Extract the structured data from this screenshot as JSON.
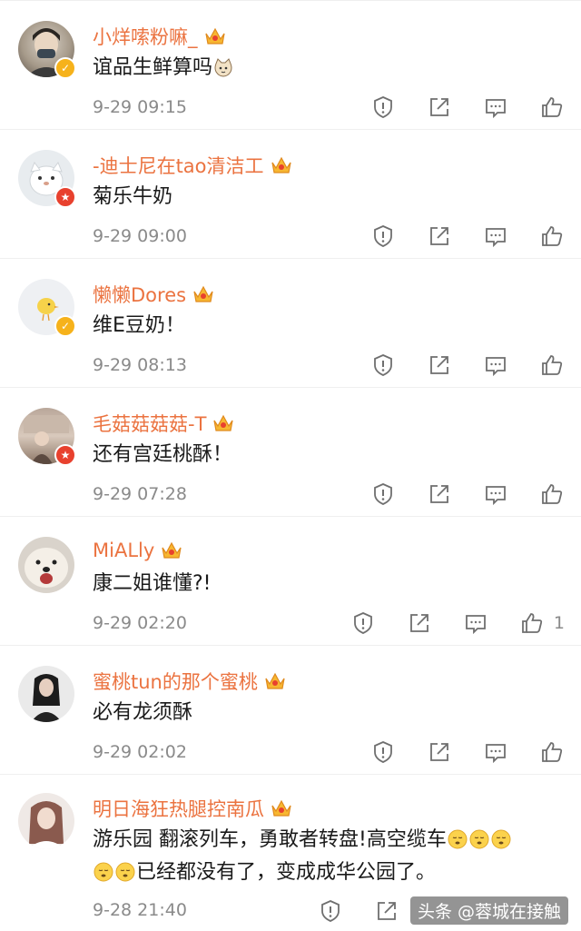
{
  "comments": [
    {
      "username": "小烊嗦粉嘛_",
      "text": "谊品生鲜算吗",
      "time": "9-29 09:15",
      "badge": "verified",
      "like_count": ""
    },
    {
      "username": "-迪士尼在tao清洁工",
      "text": "菊乐牛奶",
      "time": "9-29 09:00",
      "badge": "star",
      "like_count": ""
    },
    {
      "username": "懒懒Dores",
      "text": "维E豆奶！",
      "time": "9-29 08:13",
      "badge": "verified",
      "like_count": ""
    },
    {
      "username": "毛菇菇菇菇-T",
      "text": "还有宫廷桃酥！",
      "time": "9-29 07:28",
      "badge": "star",
      "like_count": ""
    },
    {
      "username": "MiALly",
      "text": "康二姐谁懂?!",
      "time": "9-29 02:20",
      "badge": "",
      "like_count": "1"
    },
    {
      "username": "蜜桃tun的那个蜜桃",
      "text": "必有龙须酥",
      "time": "9-29 02:02",
      "badge": "",
      "like_count": ""
    },
    {
      "username": "明日海狂热腿控南瓜",
      "text_line1": "游乐园  翻滚列车，勇敢者转盘!高空缆车",
      "text_line2": "已经都没有了，变成成华公园了。",
      "time": "9-28 21:40",
      "badge": "",
      "like_count": ""
    }
  ],
  "watermark": "头条 @蓉城在接触",
  "colors": {
    "username": "#eb7340",
    "icon": "#6f6f6f",
    "verified_badge": "#f6b21b",
    "star_badge": "#e8412e"
  },
  "icons": [
    "report-icon",
    "share-icon",
    "comment-icon",
    "like-icon",
    "crown-icon",
    "cat-emoji",
    "sleepy-face-emoji"
  ]
}
